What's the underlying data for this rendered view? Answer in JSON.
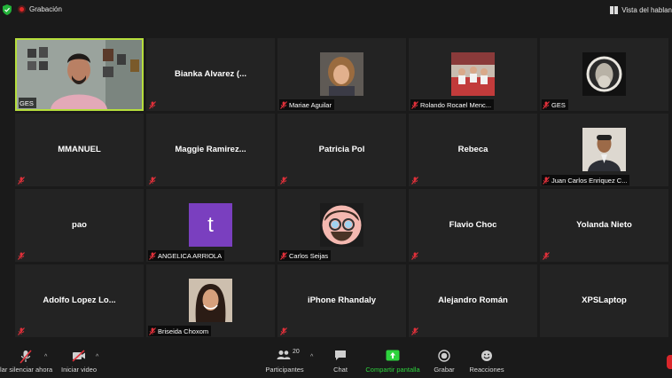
{
  "top_bar": {
    "recording_label": "Grabación",
    "view_label": "Vista del hablan"
  },
  "tiles": [
    {
      "row": 0,
      "col": 0,
      "type": "video",
      "label": "GES",
      "muted": false,
      "active": true
    },
    {
      "row": 0,
      "col": 1,
      "type": "name",
      "name": "Bianka Alvarez (...",
      "muted": true
    },
    {
      "row": 0,
      "col": 2,
      "type": "photo",
      "label": "Mariae Aguilar",
      "muted": true
    },
    {
      "row": 0,
      "col": 3,
      "type": "photo",
      "label": "Rolando Rocael Menc...",
      "muted": true
    },
    {
      "row": 0,
      "col": 4,
      "type": "photo",
      "label": "GES",
      "muted": true
    },
    {
      "row": 1,
      "col": 0,
      "type": "name",
      "name": "MMANUEL",
      "muted": true
    },
    {
      "row": 1,
      "col": 1,
      "type": "name",
      "name": "Maggie Ramirez...",
      "muted": true
    },
    {
      "row": 1,
      "col": 2,
      "type": "name",
      "name": "Patricia Pol",
      "muted": true
    },
    {
      "row": 1,
      "col": 3,
      "type": "name",
      "name": "Rebeca",
      "muted": true
    },
    {
      "row": 1,
      "col": 4,
      "type": "photo",
      "label": "Juan Carlos Enriquez C...",
      "muted": true
    },
    {
      "row": 2,
      "col": 0,
      "type": "name",
      "name": "pao",
      "muted": true
    },
    {
      "row": 2,
      "col": 1,
      "type": "letter",
      "letter": "t",
      "label": "ANGELICA ARRIOLA",
      "muted": true
    },
    {
      "row": 2,
      "col": 2,
      "type": "photo",
      "label": "Carlos Seijas",
      "muted": true
    },
    {
      "row": 2,
      "col": 3,
      "type": "name",
      "name": "Flavio Choc",
      "muted": true
    },
    {
      "row": 2,
      "col": 4,
      "type": "name",
      "name": "Yolanda Nieto",
      "muted": true
    },
    {
      "row": 3,
      "col": 0,
      "type": "name",
      "name": "Adolfo Lopez Lo...",
      "muted": true
    },
    {
      "row": 3,
      "col": 1,
      "type": "photo",
      "label": "Briseida Choxom",
      "muted": true
    },
    {
      "row": 3,
      "col": 2,
      "type": "name",
      "name": "iPhone Rhandaly",
      "muted": true
    },
    {
      "row": 3,
      "col": 3,
      "type": "name",
      "name": "Alejandro Román",
      "muted": true
    },
    {
      "row": 3,
      "col": 4,
      "type": "name",
      "name": "XPSLaptop",
      "muted": false
    }
  ],
  "toolbar": {
    "unmute_label": "lar silenciar ahora",
    "video_label": "Iniciar video",
    "participants_label": "Participantes",
    "participants_count": "20",
    "chat_label": "Chat",
    "share_label": "Compartir pantalla",
    "record_label": "Grabar",
    "reactions_label": "Reacciones"
  },
  "colors": {
    "active_border": "#b6de3c",
    "muted_icon": "#e0303a",
    "share_green": "#2dd33d",
    "tile_bg": "#232323",
    "end_button": "#d9262b"
  }
}
